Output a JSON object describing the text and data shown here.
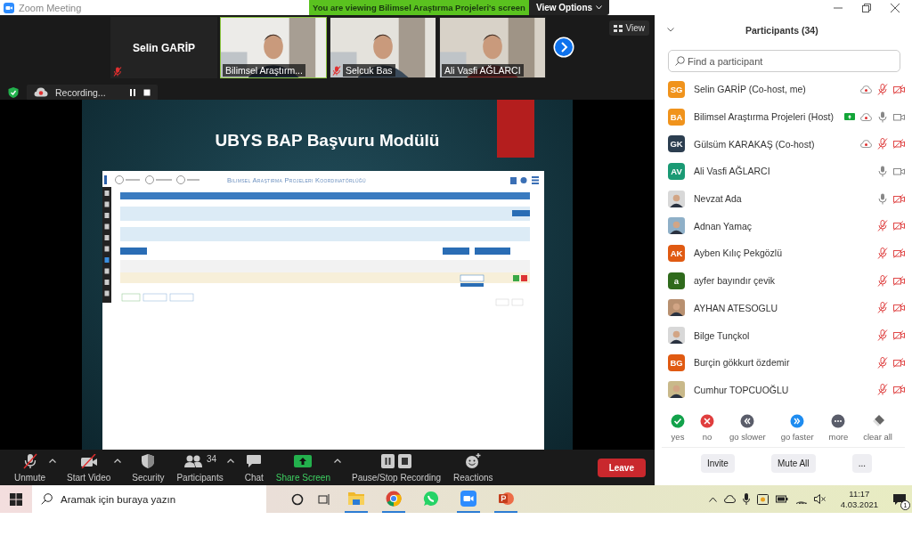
{
  "window": {
    "title": "Zoom Meeting"
  },
  "share_banner": {
    "text": "You are viewing Bilimsel Araştırma Projeleri's screen",
    "view_options": "View Options"
  },
  "video_strip": {
    "tiles": [
      {
        "kind": "name",
        "name": "Selin GARİP",
        "muted": true,
        "speaking": false
      },
      {
        "kind": "video",
        "name": "Bilimsel Araştırm...",
        "muted": false,
        "speaking": true
      },
      {
        "kind": "video",
        "name": "Selcuk Bas",
        "muted": true,
        "speaking": false
      },
      {
        "kind": "video",
        "name": "Ali Vasfi AĞLARCI",
        "muted": false,
        "speaking": false
      }
    ],
    "view_button": "View"
  },
  "recording": {
    "label": "Recording..."
  },
  "shared_screen": {
    "slide_title": "UBYS BAP Başvuru Modülü",
    "page_header": "Bilimsel Araştırma Projeleri Koordinatörlüğü"
  },
  "toolbar": {
    "items": [
      {
        "kind": "mic",
        "label": "Unmute",
        "off": true,
        "caret": true
      },
      {
        "kind": "video",
        "label": "Start Video",
        "off": true,
        "caret": true
      },
      {
        "kind": "security",
        "label": "Security",
        "caret": false
      },
      {
        "kind": "participants",
        "label": "Participants",
        "count": "34",
        "caret": true
      },
      {
        "kind": "chat",
        "label": "Chat",
        "caret": false
      },
      {
        "kind": "share",
        "label": "Share Screen",
        "caret": true
      },
      {
        "kind": "recording",
        "label": "Pause/Stop Recording",
        "caret": false
      },
      {
        "kind": "reactions",
        "label": "Reactions",
        "caret": false
      }
    ],
    "leave": "Leave"
  },
  "participants_panel": {
    "title": "Participants (34)",
    "search": {
      "placeholder": "Find a participant"
    },
    "participants": [
      {
        "kind": "initials",
        "initials": "SG",
        "color": "#f0931c",
        "name": "Selin GARİP (Co-host, me)",
        "sharing": false,
        "recording": true,
        "muted": true,
        "video_off": true
      },
      {
        "kind": "initials",
        "initials": "BA",
        "color": "#f0931c",
        "name": "Bilimsel Araştırma Projeleri (Host)",
        "sharing": true,
        "recording": true,
        "muted": false,
        "video_off": false
      },
      {
        "kind": "initials",
        "initials": "GK",
        "color": "#2c3e50",
        "name": "Gülsüm KARAKAŞ (Co-host)",
        "sharing": false,
        "recording": true,
        "muted": true,
        "video_off": true
      },
      {
        "kind": "initials",
        "initials": "AV",
        "color": "#1a9a74",
        "name": "Ali Vasfi AĞLARCI",
        "sharing": false,
        "recording": false,
        "muted": false,
        "video_off": false
      },
      {
        "name": "Nevzat Ada",
        "sharing": false,
        "recording": false,
        "muted": false,
        "video_off": true
      },
      {
        "name": "Adnan Yamaç",
        "sharing": false,
        "recording": false,
        "muted": true,
        "video_off": true
      },
      {
        "kind": "initials",
        "initials": "AK",
        "color": "#e05a12",
        "name": "Ayben Kılıç Pekgözlü",
        "sharing": false,
        "recording": false,
        "muted": true,
        "video_off": true
      },
      {
        "kind": "initials",
        "initials": "a",
        "color": "#2f6a1c",
        "name": "ayfer bayındır çevik",
        "sharing": false,
        "recording": false,
        "muted": true,
        "video_off": true
      },
      {
        "name": "AYHAN ATESOGLU",
        "sharing": false,
        "recording": false,
        "muted": true,
        "video_off": true
      },
      {
        "name": "Bilge Tunçkol",
        "sharing": false,
        "recording": false,
        "muted": true,
        "video_off": true
      },
      {
        "kind": "initials",
        "initials": "BG",
        "color": "#e05a12",
        "name": "Burçin gökkurt özdemir",
        "sharing": false,
        "recording": false,
        "muted": true,
        "video_off": true
      },
      {
        "name": "Cumhur TOPCUOĞLU",
        "sharing": false,
        "recording": false,
        "muted": true,
        "video_off": true
      }
    ],
    "feedback": [
      {
        "kind": "yes",
        "label": "yes"
      },
      {
        "kind": "no",
        "label": "no"
      },
      {
        "kind": "slower",
        "label": "go slower"
      },
      {
        "kind": "faster",
        "label": "go faster"
      },
      {
        "kind": "more",
        "label": "more"
      },
      {
        "kind": "clear",
        "label": "clear all"
      }
    ],
    "buttons": [
      "Invite",
      "Mute All",
      "..."
    ]
  },
  "taskbar": {
    "search": {
      "placeholder": "Aramak için buraya yazın"
    },
    "time": "11:17",
    "date": "4.03.2021",
    "notifications": "1"
  }
}
